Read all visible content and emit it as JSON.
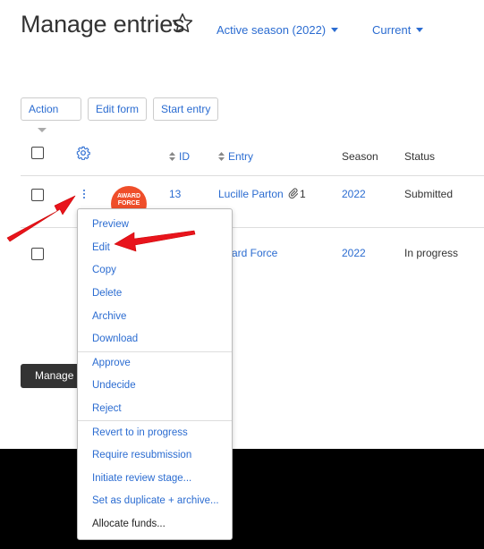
{
  "header": {
    "title": "Manage entries",
    "season_filter": "Active season (2022)",
    "view_filter": "Current"
  },
  "toolbar": {
    "action_label": "Action",
    "edit_form_label": "Edit form",
    "start_entry_label": "Start entry"
  },
  "table": {
    "columns": {
      "id": "ID",
      "entry": "Entry",
      "season": "Season",
      "status": "Status"
    },
    "rows": [
      {
        "logo_text": "AWARD FORCE",
        "id": "13",
        "entry": "Lucille Parton",
        "attachments": "1",
        "season": "2022",
        "status": "Submitted"
      },
      {
        "entry_partial": "ard Force",
        "season": "2022",
        "status": "In progress"
      }
    ]
  },
  "manage_button_label": "Manage",
  "context_menu": {
    "group1": [
      "Preview",
      "Edit",
      "Copy",
      "Delete",
      "Archive",
      "Download"
    ],
    "group2": [
      "Approve",
      "Undecide",
      "Reject"
    ],
    "group3": [
      "Revert to in progress",
      "Require resubmission",
      "Initiate review stage...",
      "Set as duplicate + archive...",
      "Allocate funds..."
    ]
  },
  "colors": {
    "link": "#2b6cd1",
    "annotation_arrow": "#e8141c",
    "logo": "#ef4e2a"
  }
}
